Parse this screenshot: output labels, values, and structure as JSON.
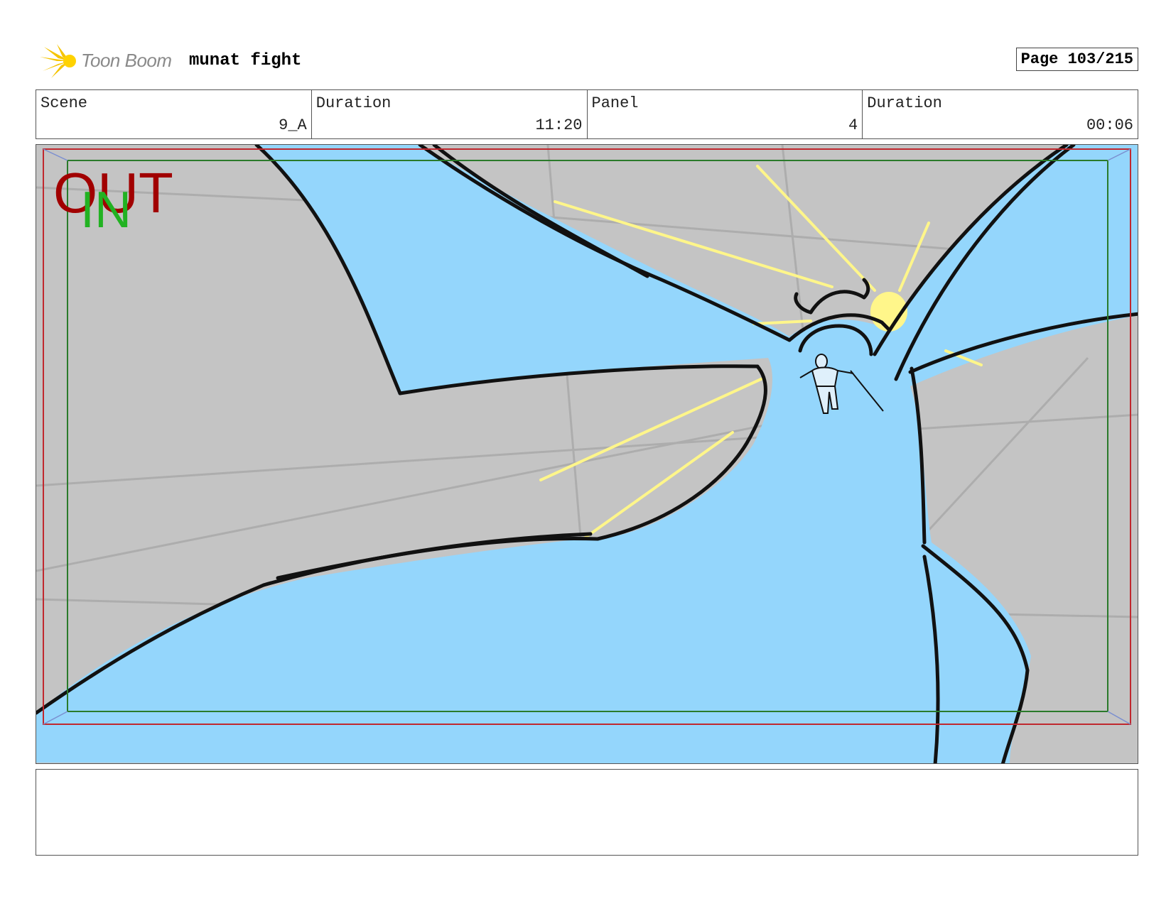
{
  "header": {
    "logo_text": "Toon Boom",
    "project_title": "munat fight",
    "page_label": "Page 103/215"
  },
  "info": {
    "scene_label": "Scene",
    "scene_value": "9_A",
    "scene_duration_label": "Duration",
    "scene_duration_value": "11:20",
    "panel_label": "Panel",
    "panel_value": "4",
    "panel_duration_label": "Duration",
    "panel_duration_value": "00:06"
  },
  "panel": {
    "out_marker": "OUT",
    "in_marker": "IN",
    "colors": {
      "sky": "#c4c4c4",
      "water": "#94d6fc",
      "glow": "#fff68a",
      "outer_safe_frame": "#c0282e",
      "inner_safe_frame": "#2a7a2a"
    }
  },
  "notes": {
    "text": ""
  }
}
